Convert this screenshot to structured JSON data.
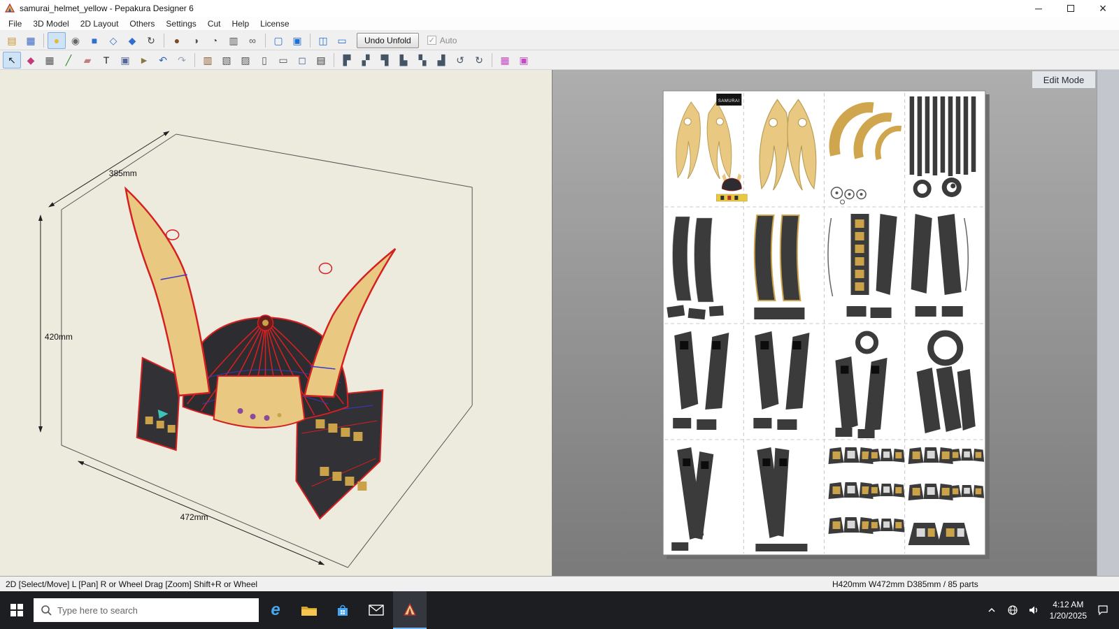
{
  "window": {
    "title": "samurai_helmet_yellow - Pepakura Designer 6",
    "controls": {
      "minimize": "─",
      "close": "×"
    }
  },
  "menu": {
    "items": [
      "File",
      "3D Model",
      "2D Layout",
      "Others",
      "Settings",
      "Cut",
      "Help",
      "License"
    ]
  },
  "toolbar1": {
    "undo_unfold_label": "Undo Unfold",
    "auto_label": "Auto",
    "auto_check_glyph": "✓",
    "icons": [
      {
        "name": "open-file-icon",
        "glyph": "▤",
        "color": "#c8912a"
      },
      {
        "name": "save-icon",
        "glyph": "▦",
        "color": "#3a66c8"
      },
      {
        "sep": true
      },
      {
        "name": "light-bulb-icon",
        "glyph": "●",
        "color": "#e2b93b",
        "active": true
      },
      {
        "name": "texture-view-icon",
        "glyph": "◉",
        "color": "#666666"
      },
      {
        "name": "shaded-view-icon",
        "glyph": "■",
        "color": "#2f6fd0"
      },
      {
        "name": "wireframe-view-icon",
        "glyph": "◇",
        "color": "#2f6fd0"
      },
      {
        "name": "flat-view-icon",
        "glyph": "◆",
        "color": "#2f6fd0"
      },
      {
        "name": "rotate-view-icon",
        "glyph": "↻",
        "color": "#444444"
      },
      {
        "sep": true
      },
      {
        "name": "material-sphere-icon",
        "glyph": "●",
        "color": "#7a4a22"
      },
      {
        "name": "texture-sphere-icon",
        "glyph": "◑",
        "color": "#555555"
      },
      {
        "name": "protractor-icon",
        "glyph": "◔",
        "color": "#555555"
      },
      {
        "name": "columns-icon",
        "glyph": "▥",
        "color": "#555555"
      },
      {
        "name": "link-edges-icon",
        "glyph": "∞",
        "color": "#555555"
      },
      {
        "sep": true
      },
      {
        "name": "select-region-icon",
        "glyph": "▢",
        "color": "#1f6fd4"
      },
      {
        "name": "region-settings-icon",
        "glyph": "▣",
        "color": "#1f6fd4"
      },
      {
        "sep": true
      },
      {
        "name": "two-pane-view-icon",
        "glyph": "◫",
        "color": "#1f6fd4"
      },
      {
        "name": "one-pane-view-icon",
        "glyph": "▭",
        "color": "#1f6fd4"
      }
    ]
  },
  "toolbar2": {
    "icons": [
      {
        "name": "select-move-icon",
        "glyph": "↖",
        "color": "#222222",
        "active": true
      },
      {
        "name": "snap-magnet-icon",
        "glyph": "◆",
        "color": "#c23a7a"
      },
      {
        "name": "divide-grid-icon",
        "glyph": "▦",
        "color": "#555555"
      },
      {
        "name": "draw-pen-icon",
        "glyph": "╱",
        "color": "#2a8a2a"
      },
      {
        "name": "eraser-icon",
        "glyph": "▰",
        "color": "#c08080"
      },
      {
        "name": "text-tool-icon",
        "glyph": "T",
        "color": "#222222"
      },
      {
        "name": "insert-image-icon",
        "glyph": "▣",
        "color": "#556699"
      },
      {
        "name": "note-icon",
        "glyph": "►",
        "color": "#887744"
      },
      {
        "name": "undo-icon",
        "glyph": "↶",
        "color": "#2a5fb8"
      },
      {
        "name": "redo-icon",
        "glyph": "↷",
        "color": "#9aa4b8"
      },
      {
        "sep": true
      },
      {
        "name": "open-book-icon",
        "glyph": "▥",
        "color": "#8a5a2a"
      },
      {
        "name": "part-list-icon",
        "glyph": "▧",
        "color": "#555555"
      },
      {
        "name": "sheet-layout-icon",
        "glyph": "▨",
        "color": "#555555"
      },
      {
        "name": "add-page-icon",
        "glyph": "▯",
        "color": "#555555"
      },
      {
        "name": "page-setup-icon",
        "glyph": "▭",
        "color": "#555555"
      },
      {
        "name": "print-preview-icon",
        "glyph": "◻",
        "color": "#556699"
      },
      {
        "name": "print-icon",
        "glyph": "▤",
        "color": "#333333"
      },
      {
        "sep": true
      },
      {
        "name": "align-left-icon",
        "glyph": "▛",
        "color": "#445566"
      },
      {
        "name": "align-center-icon",
        "glyph": "▞",
        "color": "#445566"
      },
      {
        "name": "align-right-icon",
        "glyph": "▜",
        "color": "#445566"
      },
      {
        "name": "align-top-icon",
        "glyph": "▙",
        "color": "#445566"
      },
      {
        "name": "align-middle-icon",
        "glyph": "▚",
        "color": "#445566"
      },
      {
        "name": "align-bottom-icon",
        "glyph": "▟",
        "color": "#445566"
      },
      {
        "name": "rotate-ccw-icon",
        "glyph": "↺",
        "color": "#445566"
      },
      {
        "name": "rotate-cw-icon",
        "glyph": "↻",
        "color": "#445566"
      },
      {
        "sep": true
      },
      {
        "name": "join-edge-icon",
        "glyph": "▦",
        "color": "#c24ac2"
      },
      {
        "name": "edge-color-icon",
        "glyph": "▣",
        "color": "#c24ac2"
      }
    ]
  },
  "viewport3d": {
    "width_label": "385mm",
    "height_label": "420mm",
    "depth_label": "472mm"
  },
  "viewport2d": {
    "edit_mode_label": "Edit Mode",
    "logo_text": "SAMURAI"
  },
  "statusbar": {
    "left": "2D [Select/Move] L [Pan] R or Wheel Drag [Zoom] Shift+R or Wheel",
    "right": "H420mm W472mm D385mm / 85 parts"
  },
  "taskbar": {
    "search_placeholder": "Type here to search",
    "edge_glyph": "e",
    "clock": {
      "time": "4:12 AM",
      "date": "1/20/2025"
    }
  },
  "colors": {
    "tan": "#e9c981",
    "tanDark": "#cfa64e",
    "dark": "#3b3b3b",
    "gold": "#caa24a",
    "red": "#d42020",
    "blue": "#3a3acc",
    "bg3d": "#edeade",
    "accent": "#2f6fd0"
  }
}
